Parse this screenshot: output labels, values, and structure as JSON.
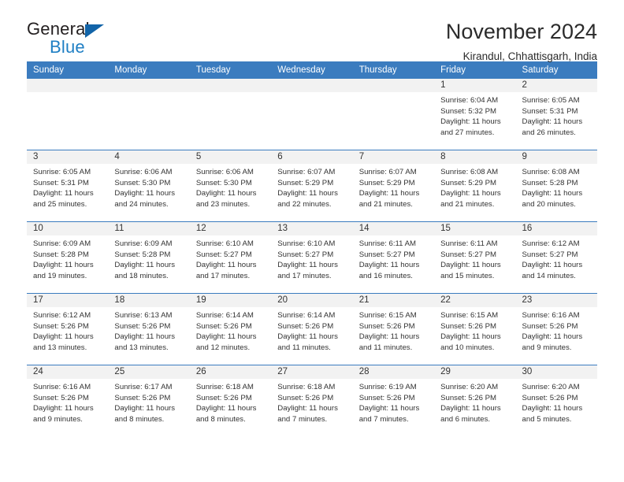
{
  "logo": {
    "primary_text": "General",
    "secondary_text": "Blue",
    "brand_blue": "#1f7fc4",
    "triangle_color": "#1264a8"
  },
  "header": {
    "title": "November 2024",
    "subtitle": "Kirandul, Chhattisgarh, India"
  },
  "colors": {
    "header_row_bg": "#3b7cbf",
    "date_strip_bg": "#f2f2f2",
    "text": "#333333"
  },
  "calendar": {
    "weekday_headers": [
      "Sunday",
      "Monday",
      "Tuesday",
      "Wednesday",
      "Thursday",
      "Friday",
      "Saturday"
    ],
    "labels": {
      "sunrise": "Sunrise:",
      "sunset": "Sunset:",
      "daylight": "Daylight:"
    },
    "weeks": [
      [
        {
          "day": "",
          "sunrise": "",
          "sunset": "",
          "daylight": ""
        },
        {
          "day": "",
          "sunrise": "",
          "sunset": "",
          "daylight": ""
        },
        {
          "day": "",
          "sunrise": "",
          "sunset": "",
          "daylight": ""
        },
        {
          "day": "",
          "sunrise": "",
          "sunset": "",
          "daylight": ""
        },
        {
          "day": "",
          "sunrise": "",
          "sunset": "",
          "daylight": ""
        },
        {
          "day": "1",
          "sunrise": "Sunrise: 6:04 AM",
          "sunset": "Sunset: 5:32 PM",
          "daylight": "Daylight: 11 hours and 27 minutes."
        },
        {
          "day": "2",
          "sunrise": "Sunrise: 6:05 AM",
          "sunset": "Sunset: 5:31 PM",
          "daylight": "Daylight: 11 hours and 26 minutes."
        }
      ],
      [
        {
          "day": "3",
          "sunrise": "Sunrise: 6:05 AM",
          "sunset": "Sunset: 5:31 PM",
          "daylight": "Daylight: 11 hours and 25 minutes."
        },
        {
          "day": "4",
          "sunrise": "Sunrise: 6:06 AM",
          "sunset": "Sunset: 5:30 PM",
          "daylight": "Daylight: 11 hours and 24 minutes."
        },
        {
          "day": "5",
          "sunrise": "Sunrise: 6:06 AM",
          "sunset": "Sunset: 5:30 PM",
          "daylight": "Daylight: 11 hours and 23 minutes."
        },
        {
          "day": "6",
          "sunrise": "Sunrise: 6:07 AM",
          "sunset": "Sunset: 5:29 PM",
          "daylight": "Daylight: 11 hours and 22 minutes."
        },
        {
          "day": "7",
          "sunrise": "Sunrise: 6:07 AM",
          "sunset": "Sunset: 5:29 PM",
          "daylight": "Daylight: 11 hours and 21 minutes."
        },
        {
          "day": "8",
          "sunrise": "Sunrise: 6:08 AM",
          "sunset": "Sunset: 5:29 PM",
          "daylight": "Daylight: 11 hours and 21 minutes."
        },
        {
          "day": "9",
          "sunrise": "Sunrise: 6:08 AM",
          "sunset": "Sunset: 5:28 PM",
          "daylight": "Daylight: 11 hours and 20 minutes."
        }
      ],
      [
        {
          "day": "10",
          "sunrise": "Sunrise: 6:09 AM",
          "sunset": "Sunset: 5:28 PM",
          "daylight": "Daylight: 11 hours and 19 minutes."
        },
        {
          "day": "11",
          "sunrise": "Sunrise: 6:09 AM",
          "sunset": "Sunset: 5:28 PM",
          "daylight": "Daylight: 11 hours and 18 minutes."
        },
        {
          "day": "12",
          "sunrise": "Sunrise: 6:10 AM",
          "sunset": "Sunset: 5:27 PM",
          "daylight": "Daylight: 11 hours and 17 minutes."
        },
        {
          "day": "13",
          "sunrise": "Sunrise: 6:10 AM",
          "sunset": "Sunset: 5:27 PM",
          "daylight": "Daylight: 11 hours and 17 minutes."
        },
        {
          "day": "14",
          "sunrise": "Sunrise: 6:11 AM",
          "sunset": "Sunset: 5:27 PM",
          "daylight": "Daylight: 11 hours and 16 minutes."
        },
        {
          "day": "15",
          "sunrise": "Sunrise: 6:11 AM",
          "sunset": "Sunset: 5:27 PM",
          "daylight": "Daylight: 11 hours and 15 minutes."
        },
        {
          "day": "16",
          "sunrise": "Sunrise: 6:12 AM",
          "sunset": "Sunset: 5:27 PM",
          "daylight": "Daylight: 11 hours and 14 minutes."
        }
      ],
      [
        {
          "day": "17",
          "sunrise": "Sunrise: 6:12 AM",
          "sunset": "Sunset: 5:26 PM",
          "daylight": "Daylight: 11 hours and 13 minutes."
        },
        {
          "day": "18",
          "sunrise": "Sunrise: 6:13 AM",
          "sunset": "Sunset: 5:26 PM",
          "daylight": "Daylight: 11 hours and 13 minutes."
        },
        {
          "day": "19",
          "sunrise": "Sunrise: 6:14 AM",
          "sunset": "Sunset: 5:26 PM",
          "daylight": "Daylight: 11 hours and 12 minutes."
        },
        {
          "day": "20",
          "sunrise": "Sunrise: 6:14 AM",
          "sunset": "Sunset: 5:26 PM",
          "daylight": "Daylight: 11 hours and 11 minutes."
        },
        {
          "day": "21",
          "sunrise": "Sunrise: 6:15 AM",
          "sunset": "Sunset: 5:26 PM",
          "daylight": "Daylight: 11 hours and 11 minutes."
        },
        {
          "day": "22",
          "sunrise": "Sunrise: 6:15 AM",
          "sunset": "Sunset: 5:26 PM",
          "daylight": "Daylight: 11 hours and 10 minutes."
        },
        {
          "day": "23",
          "sunrise": "Sunrise: 6:16 AM",
          "sunset": "Sunset: 5:26 PM",
          "daylight": "Daylight: 11 hours and 9 minutes."
        }
      ],
      [
        {
          "day": "24",
          "sunrise": "Sunrise: 6:16 AM",
          "sunset": "Sunset: 5:26 PM",
          "daylight": "Daylight: 11 hours and 9 minutes."
        },
        {
          "day": "25",
          "sunrise": "Sunrise: 6:17 AM",
          "sunset": "Sunset: 5:26 PM",
          "daylight": "Daylight: 11 hours and 8 minutes."
        },
        {
          "day": "26",
          "sunrise": "Sunrise: 6:18 AM",
          "sunset": "Sunset: 5:26 PM",
          "daylight": "Daylight: 11 hours and 8 minutes."
        },
        {
          "day": "27",
          "sunrise": "Sunrise: 6:18 AM",
          "sunset": "Sunset: 5:26 PM",
          "daylight": "Daylight: 11 hours and 7 minutes."
        },
        {
          "day": "28",
          "sunrise": "Sunrise: 6:19 AM",
          "sunset": "Sunset: 5:26 PM",
          "daylight": "Daylight: 11 hours and 7 minutes."
        },
        {
          "day": "29",
          "sunrise": "Sunrise: 6:20 AM",
          "sunset": "Sunset: 5:26 PM",
          "daylight": "Daylight: 11 hours and 6 minutes."
        },
        {
          "day": "30",
          "sunrise": "Sunrise: 6:20 AM",
          "sunset": "Sunset: 5:26 PM",
          "daylight": "Daylight: 11 hours and 5 minutes."
        }
      ]
    ]
  }
}
